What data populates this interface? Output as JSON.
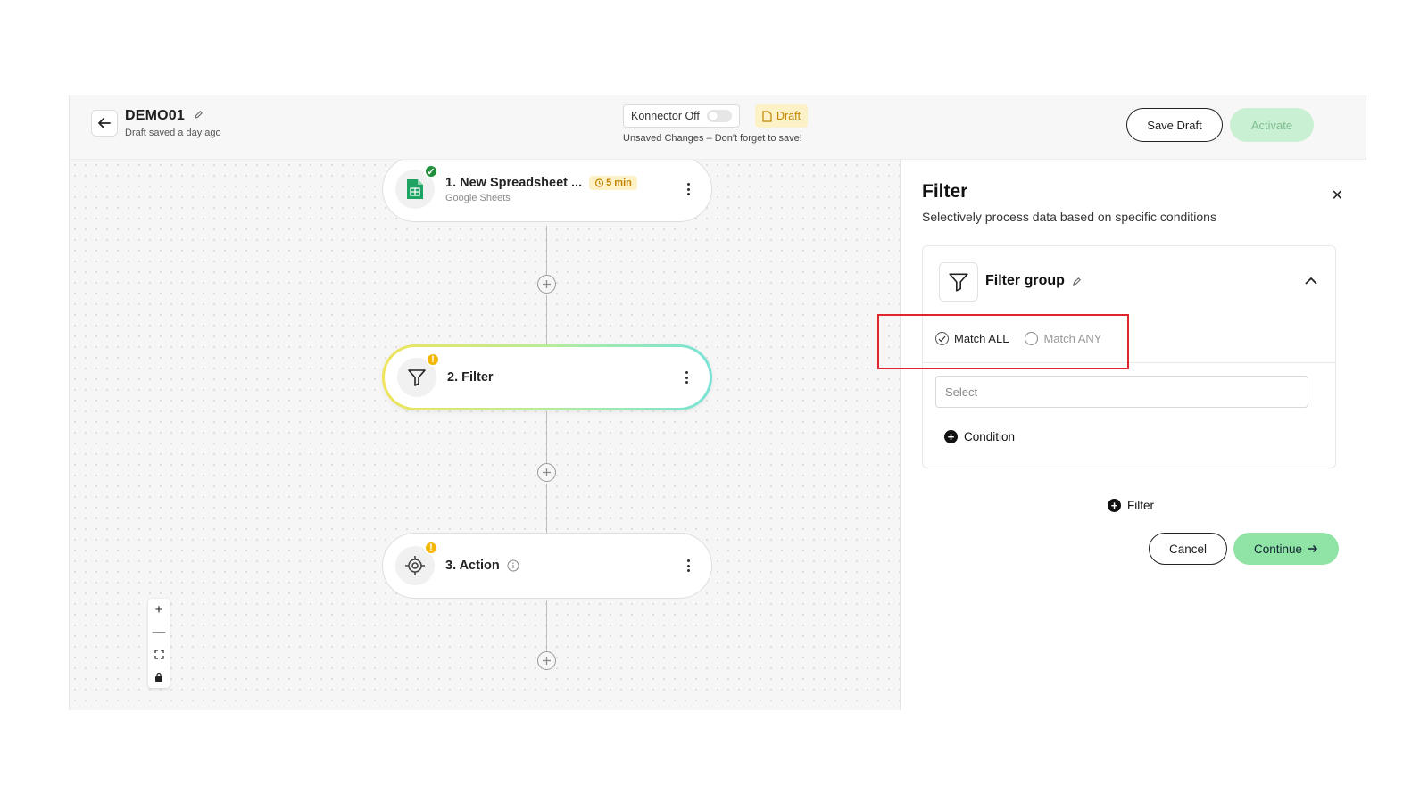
{
  "header": {
    "title": "DEMO01",
    "subtitle": "Draft saved a day ago",
    "konnector_label": "Konnector Off",
    "draft_label": "Draft",
    "unsaved_text": "Unsaved Changes – Don't forget to save!",
    "save_draft_label": "Save Draft",
    "activate_label": "Activate"
  },
  "workflow": {
    "steps": [
      {
        "title": "1. New Spreadsheet ...",
        "subtitle": "Google Sheets",
        "timer": "5 min",
        "status": "ok"
      },
      {
        "title": "2. Filter",
        "status": "warning"
      },
      {
        "title": "3. Action",
        "status": "warning"
      }
    ]
  },
  "zoom_controls": {
    "zoom_in": "+",
    "zoom_out": "—"
  },
  "panel": {
    "title": "Filter",
    "description": "Selectively process data based on specific conditions",
    "group_title": "Filter group",
    "match_all": "Match ALL",
    "match_any": "Match ANY",
    "selected_match": "Match ALL",
    "select_placeholder": "Select",
    "add_condition_label": "Condition",
    "add_filter_label": "Filter",
    "cancel_label": "Cancel",
    "continue_label": "Continue"
  },
  "colors": {
    "accent_green": "#8fe3a5",
    "draft_yellow": "#fdf1c7",
    "highlight_red": "#e0262c"
  }
}
